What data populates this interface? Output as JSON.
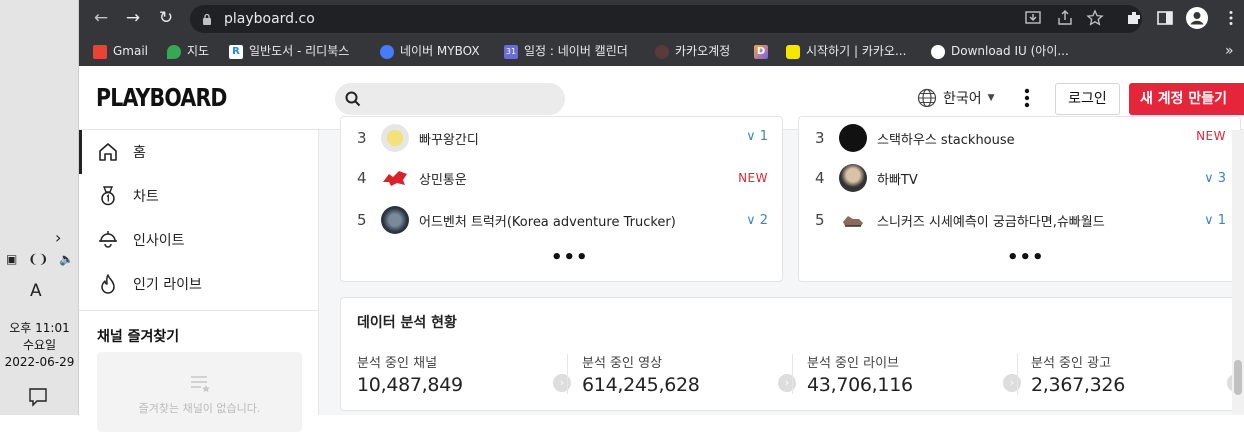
{
  "taskbar": {
    "ime_indicator": "A",
    "time": "오후 11:01",
    "weekday": "수요일",
    "date": "2022-06-29"
  },
  "browser": {
    "url": "playboard.co",
    "bookmarks": [
      {
        "label": "Gmail",
        "icon": "gmail-icon",
        "color": "#ea4335"
      },
      {
        "label": "지도",
        "icon": "maps-icon",
        "color": "#34a853"
      },
      {
        "label": "일반도서 - 리디북스",
        "icon": "ridibooks-icon",
        "color": "#ffffff"
      },
      {
        "label": "네이버 MYBOX",
        "icon": "mybox-icon",
        "color": "#4a7bf7"
      },
      {
        "label": "일정 : 네이버 캘린더",
        "icon": "calendar-icon",
        "color": "#6c6cd8"
      },
      {
        "label": "카카오계정",
        "icon": "kakao-account-icon",
        "color": "#5a3a3a"
      },
      {
        "label": "",
        "icon": "d-icon",
        "color": "#f2a83a"
      },
      {
        "label": "시작하기 | 카카오...",
        "icon": "kakao-start-icon",
        "color": "#f7e600"
      },
      {
        "label": "Download IU (아이...",
        "icon": "globe-icon",
        "color": "#ffffff"
      }
    ]
  },
  "header": {
    "logo": "PLAYBOARD",
    "language": "한국어",
    "login_label": "로그인",
    "signup_label": "새 계정 만들기"
  },
  "sidebar": {
    "items": [
      {
        "label": "홈",
        "icon": "home-icon"
      },
      {
        "label": "차트",
        "icon": "medal-icon"
      },
      {
        "label": "인사이트",
        "icon": "lamp-icon"
      },
      {
        "label": "인기 라이브",
        "icon": "fire-icon"
      }
    ],
    "favorites_title": "채널 즐겨찾기",
    "favorites_empty": "즐겨찾는 채널이 없습니다."
  },
  "left_ranking": [
    {
      "rank": "3",
      "name": "빠꾸왕간디",
      "change": "1",
      "change_type": "up"
    },
    {
      "rank": "4",
      "name": "상민통운",
      "change": "NEW",
      "change_type": "new"
    },
    {
      "rank": "5",
      "name": "어드벤처 트럭커(Korea adventure Trucker)",
      "change": "2",
      "change_type": "up"
    }
  ],
  "right_ranking": [
    {
      "rank": "3",
      "name": "스택하우스 stackhouse",
      "change": "NEW",
      "change_type": "new"
    },
    {
      "rank": "4",
      "name": "하빠TV",
      "change": "3",
      "change_type": "up"
    },
    {
      "rank": "5",
      "name": "스니커즈 시세예측이 궁금하다면,슈빠월드",
      "change": "1",
      "change_type": "up"
    }
  ],
  "more_label": "•••",
  "stats": {
    "title": "데이터 분석 현황",
    "items": [
      {
        "label": "분석 중인 채널",
        "value": "10,487,849"
      },
      {
        "label": "분석 중인 영상",
        "value": "614,245,628"
      },
      {
        "label": "분석 중인 라이브",
        "value": "43,706,116"
      },
      {
        "label": "분석 중인 광고",
        "value": "2,367,326"
      }
    ]
  },
  "colors": {
    "accent": "#e4253a",
    "rank_up": "#3a86c8",
    "chrome_bg": "#35363a"
  }
}
